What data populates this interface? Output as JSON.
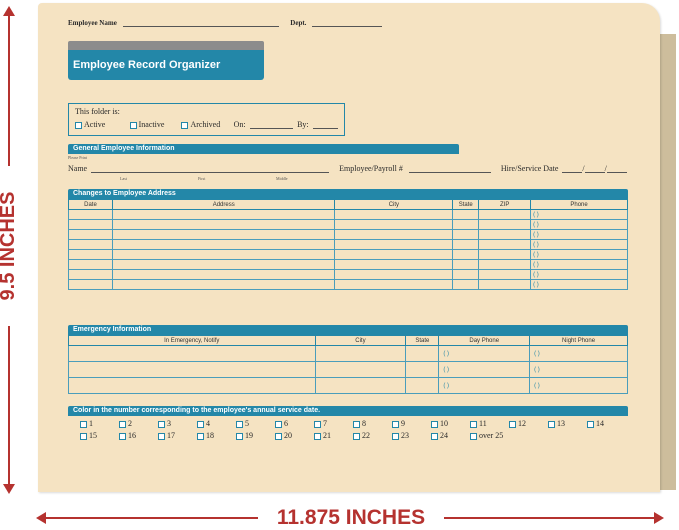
{
  "dimensions": {
    "height_label": "9.5 INCHES",
    "width_label": "11.875 INCHES"
  },
  "form": {
    "employee_name_label": "Employee Name",
    "dept_label": "Dept.",
    "title": "Employee Record Organizer",
    "status": {
      "heading": "This folder is:",
      "options": [
        "Active",
        "Inactive",
        "Archived"
      ],
      "on_label": "On:",
      "by_label": "By:"
    },
    "general": {
      "heading": "General Employee Information",
      "please_print": "Please Print",
      "name_label": "Name",
      "last": "Last",
      "first": "First",
      "middle": "Middle",
      "payroll_label": "Employee/Payroll #",
      "hire_label": "Hire/Service Date",
      "date_sep": "/"
    },
    "address": {
      "heading": "Changes to Employee Address",
      "columns": [
        "Date",
        "Address",
        "City",
        "State",
        "ZIP",
        "Phone"
      ],
      "phone_placeholder": "(           )"
    },
    "emergency": {
      "heading": "Emergency Information",
      "columns": [
        "In Emergency, Notify",
        "City",
        "State",
        "Day Phone",
        "Night Phone"
      ],
      "phone_placeholder": "(           )"
    },
    "color": {
      "heading": "Color in the number corresponding to the employee's annual service date.",
      "years": [
        "1",
        "2",
        "3",
        "4",
        "5",
        "6",
        "7",
        "8",
        "9",
        "10",
        "11",
        "12",
        "13",
        "14",
        "15",
        "16",
        "17",
        "18",
        "19",
        "20",
        "21",
        "22",
        "23",
        "24",
        "over 25"
      ]
    }
  }
}
